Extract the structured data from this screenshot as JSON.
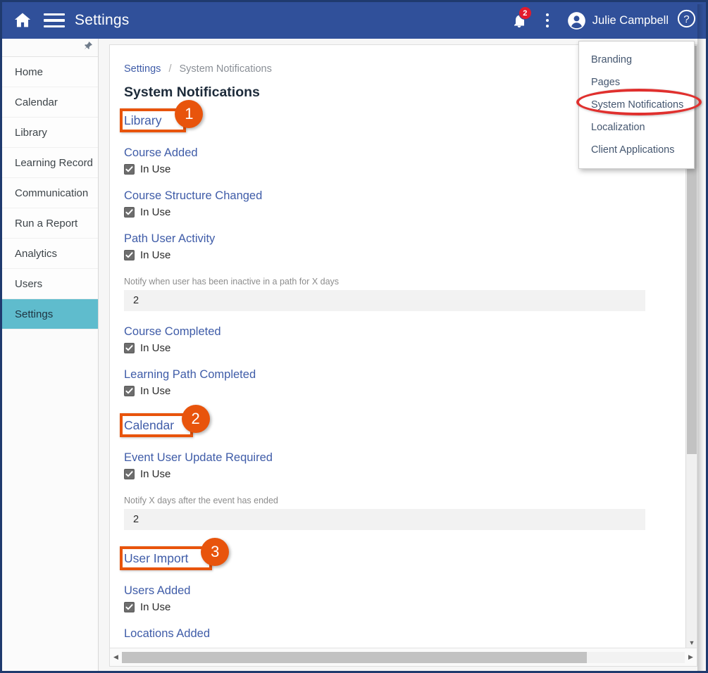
{
  "topbar": {
    "home_icon": "home-icon",
    "menu_icon": "hamburger-menu-icon",
    "title": "Settings",
    "notifications_icon": "bell-icon",
    "notifications_count": "2",
    "kebab_icon": "more-vertical-icon",
    "avatar_icon": "user-avatar-icon",
    "user_name": "Julie Campbell",
    "help_icon": "help-circle-icon",
    "background_color": "#30509a"
  },
  "sidebar": {
    "pin_icon": "pushpin-icon",
    "active_color": "#5fbccd",
    "items": [
      {
        "label": "Home",
        "active": false
      },
      {
        "label": "Calendar",
        "active": false
      },
      {
        "label": "Library",
        "active": false
      },
      {
        "label": "Learning Record",
        "active": false
      },
      {
        "label": "Communication",
        "active": false
      },
      {
        "label": "Run a Report",
        "active": false
      },
      {
        "label": "Analytics",
        "active": false
      },
      {
        "label": "Users",
        "active": false
      },
      {
        "label": "Settings",
        "active": true
      }
    ]
  },
  "breadcrumb": {
    "parent": "Settings",
    "separator": "/",
    "current": "System Notifications"
  },
  "page": {
    "title": "System Notifications"
  },
  "sections": [
    {
      "heading": "Library",
      "marker": "1",
      "items": [
        {
          "title": "Course Added",
          "checkbox_label": "In Use",
          "checked": true
        },
        {
          "title": "Course Structure Changed",
          "checkbox_label": "In Use",
          "checked": true
        },
        {
          "title": "Path User Activity",
          "checkbox_label": "In Use",
          "checked": true,
          "field_label": "Notify when user has been inactive in a path for X days",
          "field_value": "2"
        },
        {
          "title": "Course Completed",
          "checkbox_label": "In Use",
          "checked": true
        },
        {
          "title": "Learning Path Completed",
          "checkbox_label": "In Use",
          "checked": true
        }
      ]
    },
    {
      "heading": "Calendar",
      "marker": "2",
      "items": [
        {
          "title": "Event User Update Required",
          "checkbox_label": "In Use",
          "checked": true,
          "field_label": "Notify X days after the event has ended",
          "field_value": "2"
        }
      ]
    },
    {
      "heading": "User Import",
      "marker": "3",
      "items": [
        {
          "title": "Users Added",
          "checkbox_label": "In Use",
          "checked": true
        },
        {
          "title": "Locations Added",
          "checkbox_label": "",
          "checked": false
        }
      ]
    }
  ],
  "dropdown": {
    "items": [
      {
        "label": "Branding",
        "highlighted": false
      },
      {
        "label": "Pages",
        "highlighted": false
      },
      {
        "label": "System Notifications",
        "highlighted": true
      },
      {
        "label": "Localization",
        "highlighted": false
      },
      {
        "label": "Client Applications",
        "highlighted": false
      }
    ]
  },
  "annotation_colors": {
    "marker_orange": "#e8540c",
    "highlight_red": "#e0302e"
  }
}
